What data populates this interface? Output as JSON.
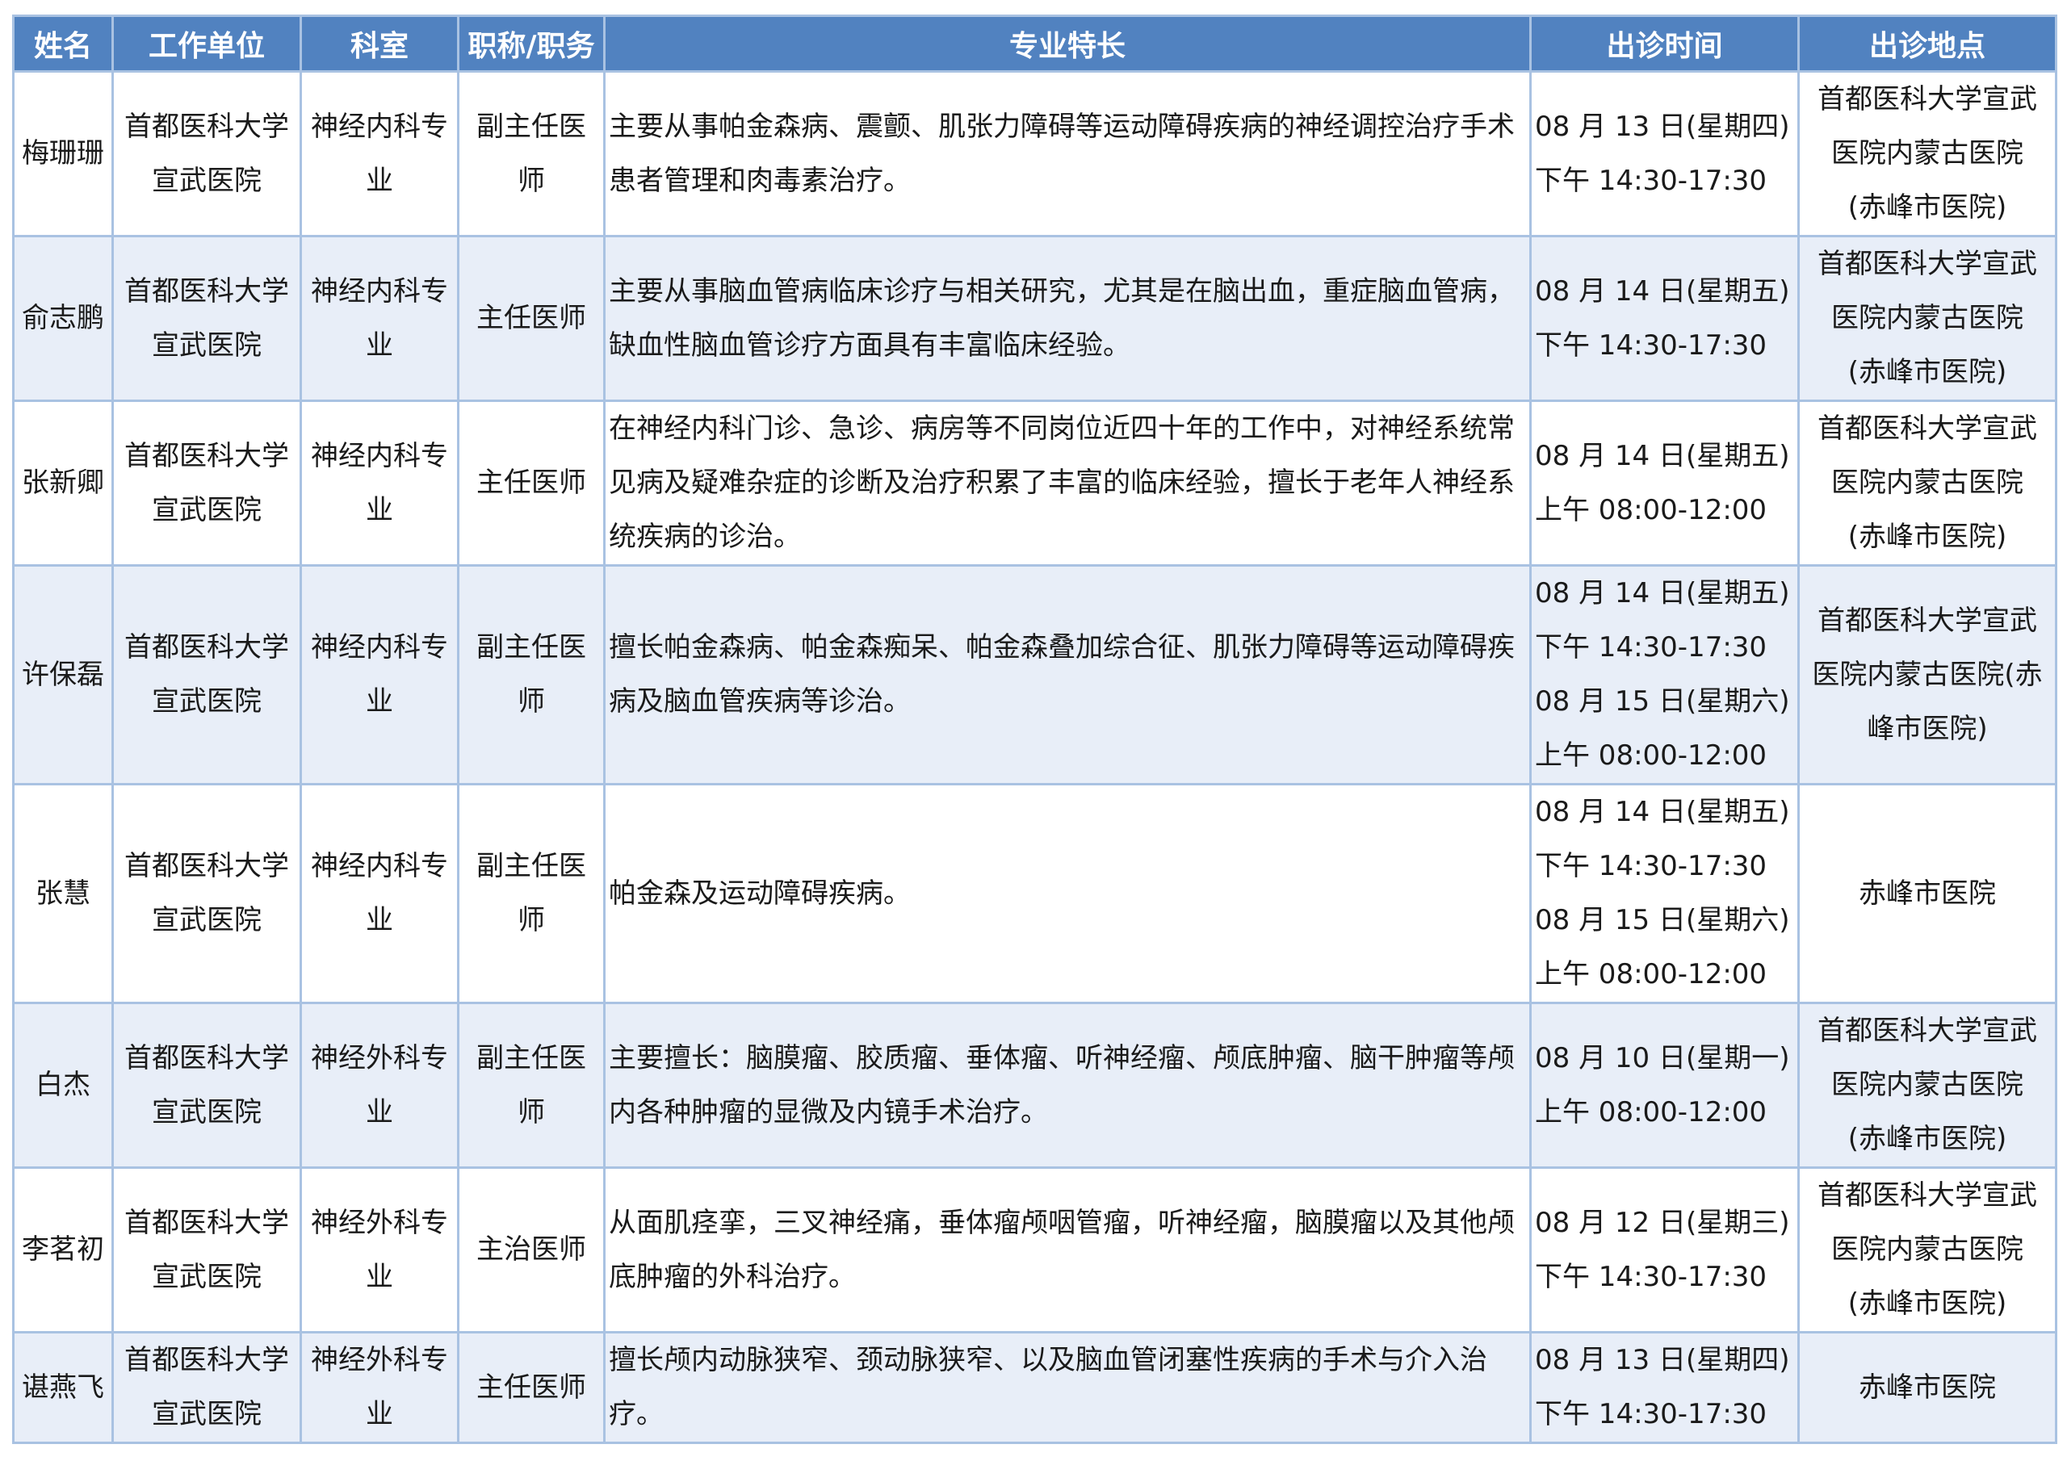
{
  "headers": [
    "姓名",
    "工作单位",
    "科室",
    "职称/职务",
    "专业特长",
    "出诊时间",
    "出诊地点"
  ],
  "rows": [
    {
      "name": "梅珊珊",
      "unit": [
        "首都医科大学",
        "宣武医院"
      ],
      "dept": [
        "神经内科专",
        "业"
      ],
      "title": [
        "副主任医",
        "师"
      ],
      "specialty": "主要从事帕金森病、震颤、肌张力障碍等运动障碍疾病的神经调控治疗手术患者管理和肉毒素治疗。",
      "time": [
        "08 月 13 日(星期四)",
        "下午 14:30-17:30"
      ],
      "location": [
        "首都医科大学宣武",
        "医院内蒙古医院",
        "(赤峰市医院)"
      ]
    },
    {
      "name": "俞志鹏",
      "unit": [
        "首都医科大学",
        "宣武医院"
      ],
      "dept": [
        "神经内科专",
        "业"
      ],
      "title": [
        "主任医师"
      ],
      "specialty": "主要从事脑血管病临床诊疗与相关研究，尤其是在脑出血，重症脑血管病，缺血性脑血管诊疗方面具有丰富临床经验。",
      "time": [
        "08 月 14 日(星期五)",
        "下午 14:30-17:30"
      ],
      "location": [
        "首都医科大学宣武",
        "医院内蒙古医院",
        "(赤峰市医院)"
      ]
    },
    {
      "name": "张新卿",
      "unit": [
        "首都医科大学",
        "宣武医院"
      ],
      "dept": [
        "神经内科专",
        "业"
      ],
      "title": [
        "主任医师"
      ],
      "specialty": "在神经内科门诊、急诊、病房等不同岗位近四十年的工作中，对神经系统常见病及疑难杂症的诊断及治疗积累了丰富的临床经验，擅长于老年人神经系统疾病的诊治。",
      "time": [
        "08 月 14 日(星期五)",
        "上午 08:00-12:00"
      ],
      "location": [
        "首都医科大学宣武",
        "医院内蒙古医院",
        "(赤峰市医院)"
      ]
    },
    {
      "name": "许保磊",
      "unit": [
        "首都医科大学",
        "宣武医院"
      ],
      "dept": [
        "神经内科专",
        "业"
      ],
      "title": [
        "副主任医",
        "师"
      ],
      "specialty": "擅长帕金森病、帕金森痴呆、帕金森叠加综合征、肌张力障碍等运动障碍疾病及脑血管疾病等诊治。",
      "time": [
        "08 月 14 日(星期五)",
        "下午 14:30-17:30",
        "08 月 15 日(星期六)",
        "上午 08:00-12:00"
      ],
      "location": [
        "首都医科大学宣武",
        "医院内蒙古医院(赤",
        "峰市医院)"
      ]
    },
    {
      "name": "张慧",
      "unit": [
        "首都医科大学",
        "宣武医院"
      ],
      "dept": [
        "神经内科专",
        "业"
      ],
      "title": [
        "副主任医",
        "师"
      ],
      "specialty": "帕金森及运动障碍疾病。",
      "time": [
        "08 月 14 日(星期五)",
        "下午 14:30-17:30",
        "08 月 15 日(星期六)",
        "上午 08:00-12:00"
      ],
      "location": [
        "赤峰市医院"
      ]
    },
    {
      "name": "白杰",
      "unit": [
        "首都医科大学",
        "宣武医院"
      ],
      "dept": [
        "神经外科专",
        "业"
      ],
      "title": [
        "副主任医",
        "师"
      ],
      "specialty": "主要擅长：脑膜瘤、胶质瘤、垂体瘤、听神经瘤、颅底肿瘤、脑干肿瘤等颅内各种肿瘤的显微及内镜手术治疗。",
      "time": [
        "08 月 10 日(星期一)",
        "上午 08:00-12:00"
      ],
      "location": [
        "首都医科大学宣武",
        "医院内蒙古医院",
        "(赤峰市医院)"
      ]
    },
    {
      "name": "李茗初",
      "unit": [
        "首都医科大学",
        "宣武医院"
      ],
      "dept": [
        "神经外科专",
        "业"
      ],
      "title": [
        "主治医师"
      ],
      "specialty": "从面肌痉挛，三叉神经痛，垂体瘤颅咽管瘤，听神经瘤，脑膜瘤以及其他颅底肿瘤的外科治疗。",
      "time": [
        "08 月 12 日(星期三)",
        "下午 14:30-17:30"
      ],
      "location": [
        "首都医科大学宣武",
        "医院内蒙古医院",
        "(赤峰市医院)"
      ]
    },
    {
      "name": "谌燕飞",
      "unit": [
        "首都医科大学",
        "宣武医院"
      ],
      "dept": [
        "神经外科专",
        "业"
      ],
      "title": [
        "主任医师"
      ],
      "specialty": "擅长颅内动脉狭窄、颈动脉狭窄、以及脑血管闭塞性疾病的手术与介入治疗。",
      "time": [
        "08 月 13 日(星期四)",
        "下午 14:30-17:30"
      ],
      "location": [
        "赤峰市医院"
      ]
    }
  ]
}
